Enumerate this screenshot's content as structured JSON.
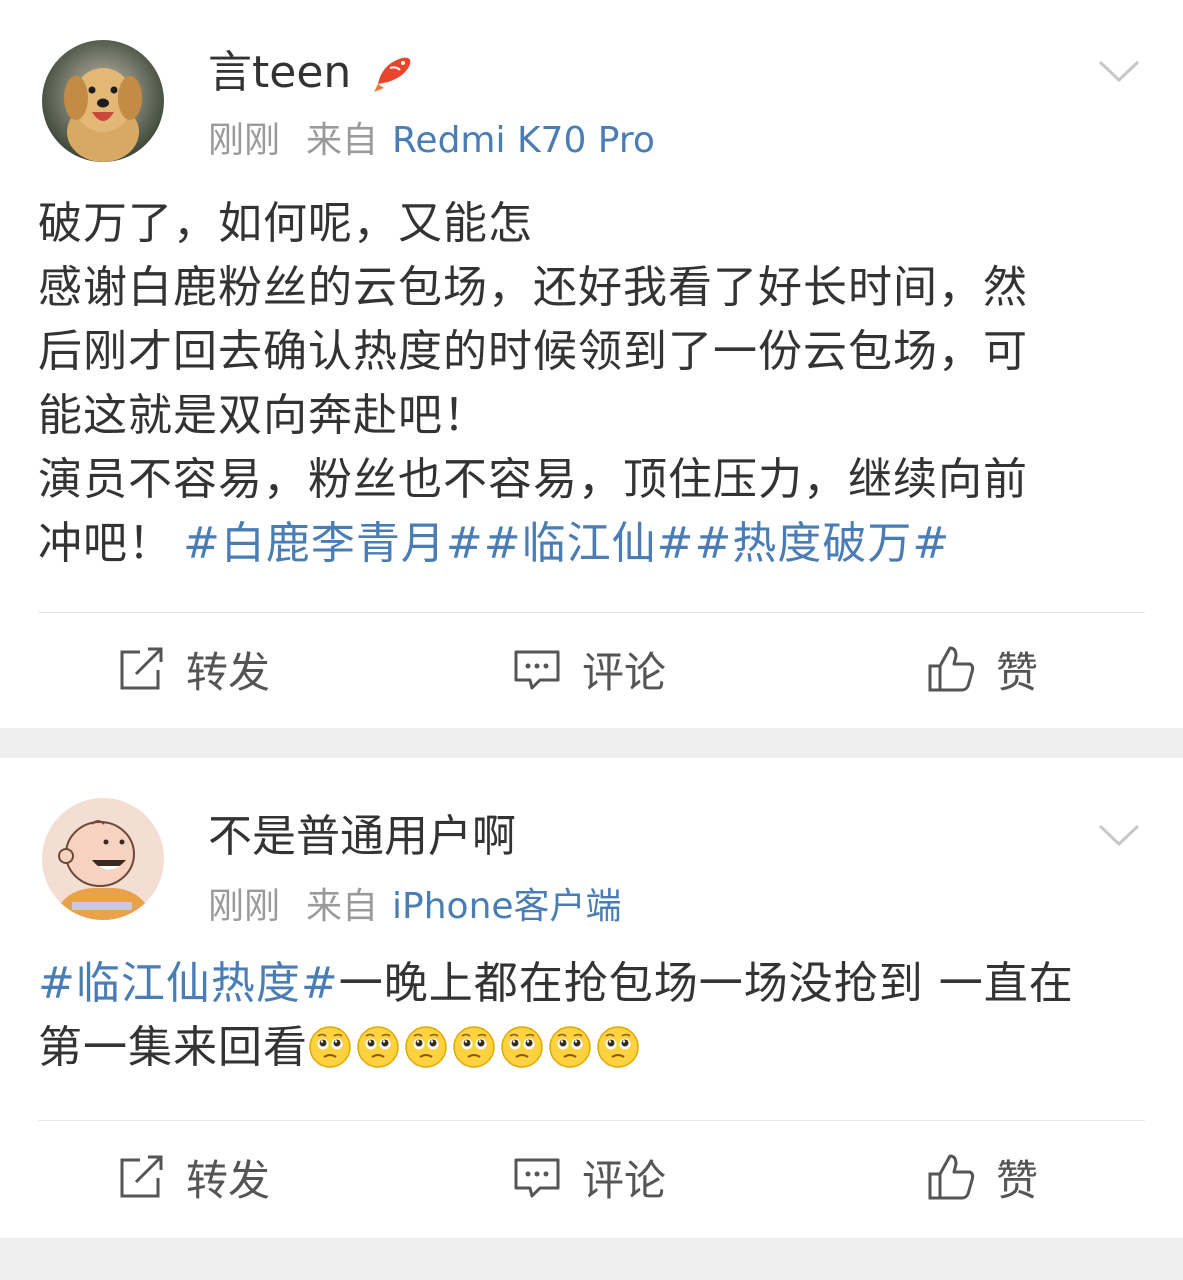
{
  "posts": [
    {
      "username": "言teen",
      "time": "刚刚",
      "source_prefix": "来自",
      "source": "Redmi K70 Pro",
      "badge_icon": "koi-fish-icon",
      "content_lines": [
        "破万了，如何呢，又能怎",
        "感谢白鹿粉丝的云包场，还好我看了好长时间，然",
        "后刚才回去确认热度的时候领到了一份云包场，可",
        "能这就是双向奔赴吧！",
        "演员不容易，粉丝也不容易，顶住压力，继续向前",
        "冲吧！"
      ],
      "hashtags": "#白鹿李青月##临江仙##热度破万#",
      "actions": {
        "repost": "转发",
        "comment": "评论",
        "like": "赞"
      }
    },
    {
      "username": "不是普通用户啊",
      "time": "刚刚",
      "source_prefix": "来自",
      "source": "iPhone客户端",
      "content_hashtag": "#临江仙热度#",
      "content_line1": "一晚上都在抢包场一场没抢到 一直在",
      "content_line2": "第一集来回看",
      "emoji_icon": "pleading-face-icon",
      "emoji_count": 7,
      "actions": {
        "repost": "转发",
        "comment": "评论",
        "like": "赞"
      }
    }
  ],
  "colors": {
    "link": "#4a7db5",
    "text": "#333333",
    "meta": "#9a9a9a",
    "separator": "#efefef"
  }
}
